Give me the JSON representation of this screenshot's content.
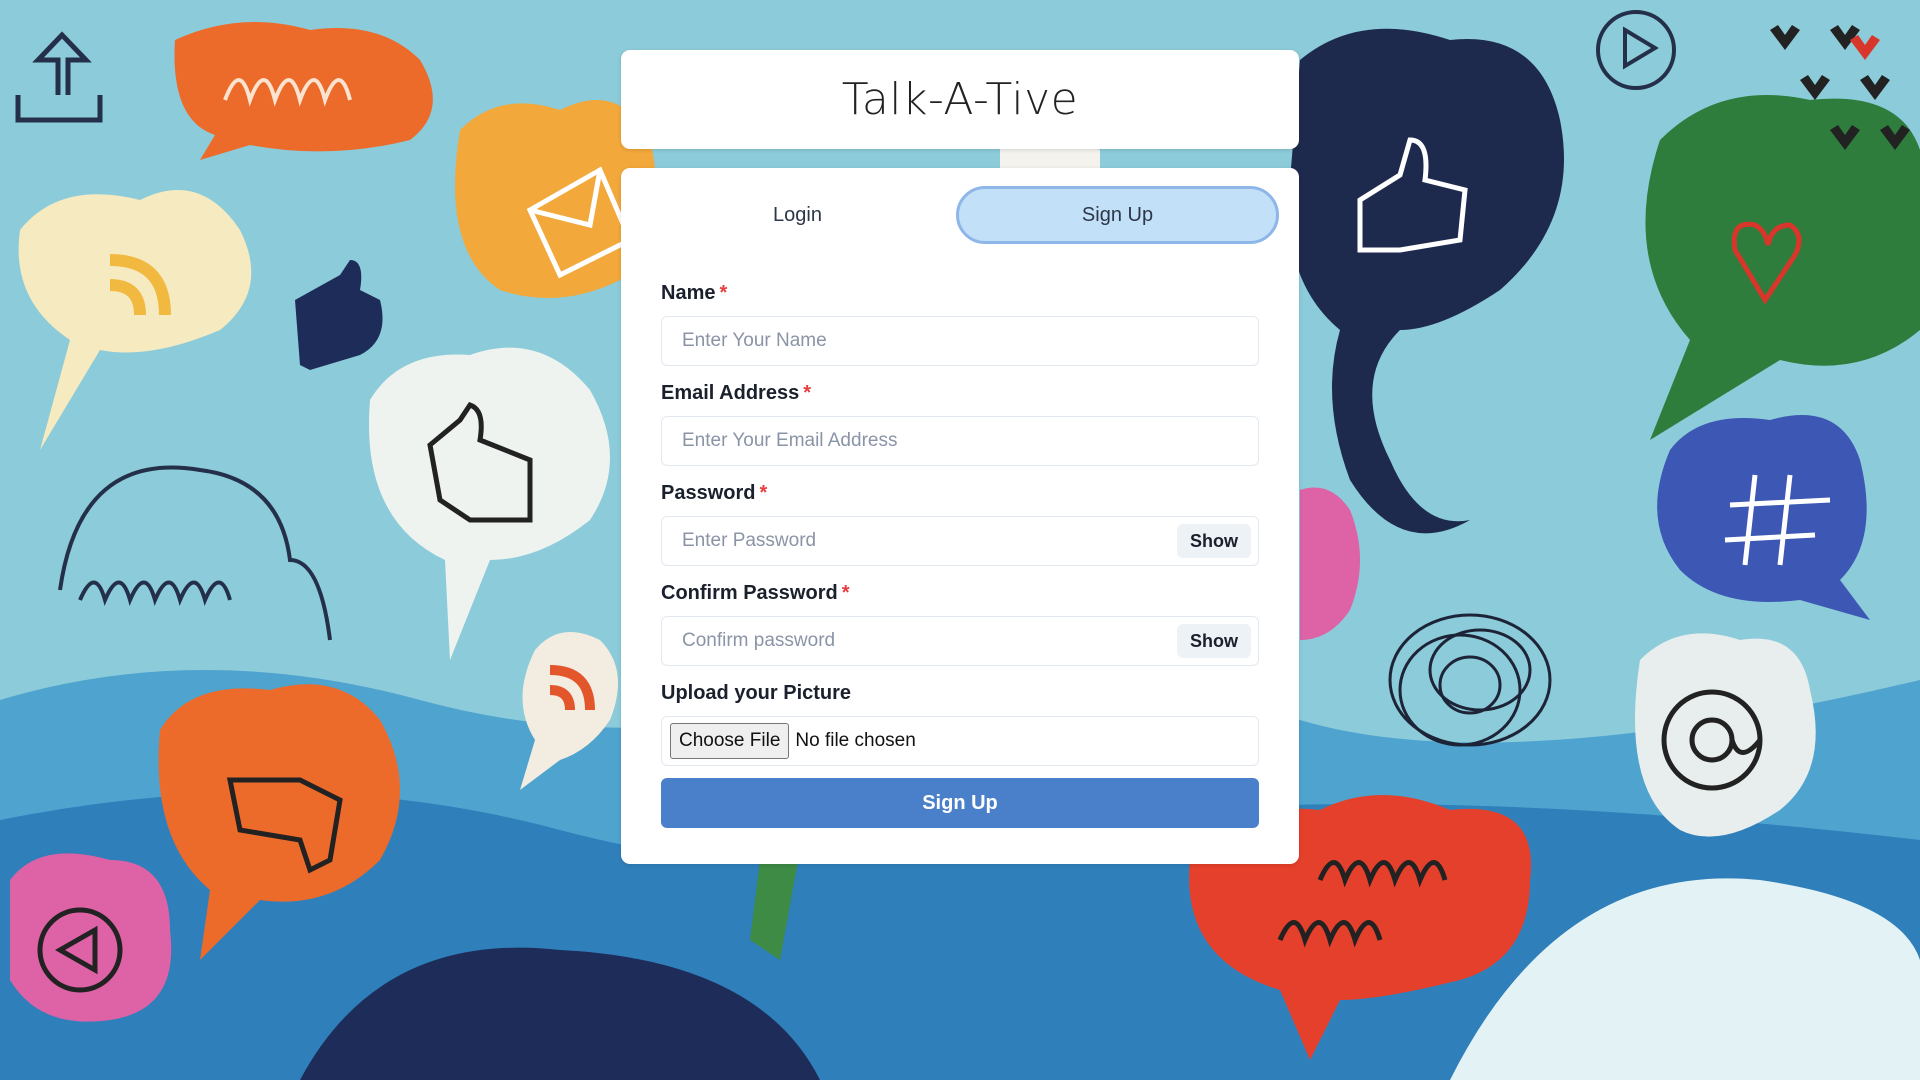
{
  "app": {
    "title": "Talk-A-Tive"
  },
  "tabs": [
    {
      "label": "Login",
      "active": false
    },
    {
      "label": "Sign Up",
      "active": true
    }
  ],
  "form": {
    "name": {
      "label": "Name",
      "required_mark": "*",
      "placeholder": "Enter Your Name"
    },
    "email": {
      "label": "Email Address",
      "required_mark": "*",
      "placeholder": "Enter Your Email Address"
    },
    "password": {
      "label": "Password",
      "required_mark": "*",
      "placeholder": "Enter Password",
      "toggle_label": "Show"
    },
    "confirm_password": {
      "label": "Confirm Password",
      "required_mark": "*",
      "placeholder": "Confirm password",
      "toggle_label": "Show"
    },
    "picture": {
      "label": "Upload your Picture",
      "button_label": "Choose File",
      "status": "No file chosen"
    },
    "submit_label": "Sign Up"
  },
  "colors": {
    "background": "#8ccbd9",
    "active_tab": "#c2e0f7",
    "submit_button": "#4a80c9",
    "required": "#e53e3e"
  },
  "icons": [
    "upload-icon",
    "thumbs-up-icon",
    "thumbs-down-icon",
    "rss-icon",
    "play-icon",
    "hashtag-icon",
    "at-sign-icon",
    "heart-icon",
    "envelope-icon"
  ]
}
